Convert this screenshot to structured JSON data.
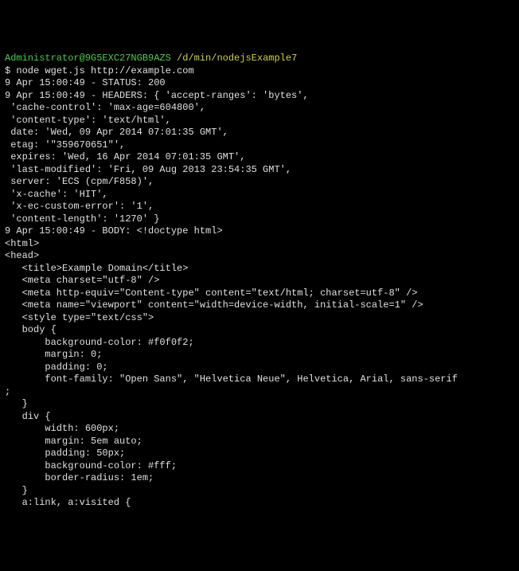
{
  "prompt": {
    "user": "Administrator@9G5EXC27NGB9AZS",
    "path": "/d/min/nodejsExample7",
    "symbol": "$",
    "command": "node wget.js http://example.com"
  },
  "lines": [
    "9 Apr 15:00:49 - STATUS: 200",
    "9 Apr 15:00:49 - HEADERS: { 'accept-ranges': 'bytes',",
    " 'cache-control': 'max-age=604800',",
    " 'content-type': 'text/html',",
    " date: 'Wed, 09 Apr 2014 07:01:35 GMT',",
    " etag: '\"359670651\"',",
    " expires: 'Wed, 16 Apr 2014 07:01:35 GMT',",
    " 'last-modified': 'Fri, 09 Aug 2013 23:54:35 GMT',",
    " server: 'ECS (cpm/F858)',",
    " 'x-cache': 'HIT',",
    " 'x-ec-custom-error': '1',",
    " 'content-length': '1270' }",
    "9 Apr 15:00:49 - BODY: <!doctype html>",
    "<html>",
    "<head>",
    "   <title>Example Domain</title>",
    "",
    "   <meta charset=\"utf-8\" />",
    "   <meta http-equiv=\"Content-type\" content=\"text/html; charset=utf-8\" />",
    "   <meta name=\"viewport\" content=\"width=device-width, initial-scale=1\" />",
    "   <style type=\"text/css\">",
    "   body {",
    "       background-color: #f0f0f2;",
    "       margin: 0;",
    "       padding: 0;",
    "       font-family: \"Open Sans\", \"Helvetica Neue\", Helvetica, Arial, sans-serif",
    ";",
    "",
    "   }",
    "   div {",
    "       width: 600px;",
    "       margin: 5em auto;",
    "       padding: 50px;",
    "       background-color: #fff;",
    "       border-radius: 1em;",
    "   }",
    "   a:link, a:visited {"
  ]
}
